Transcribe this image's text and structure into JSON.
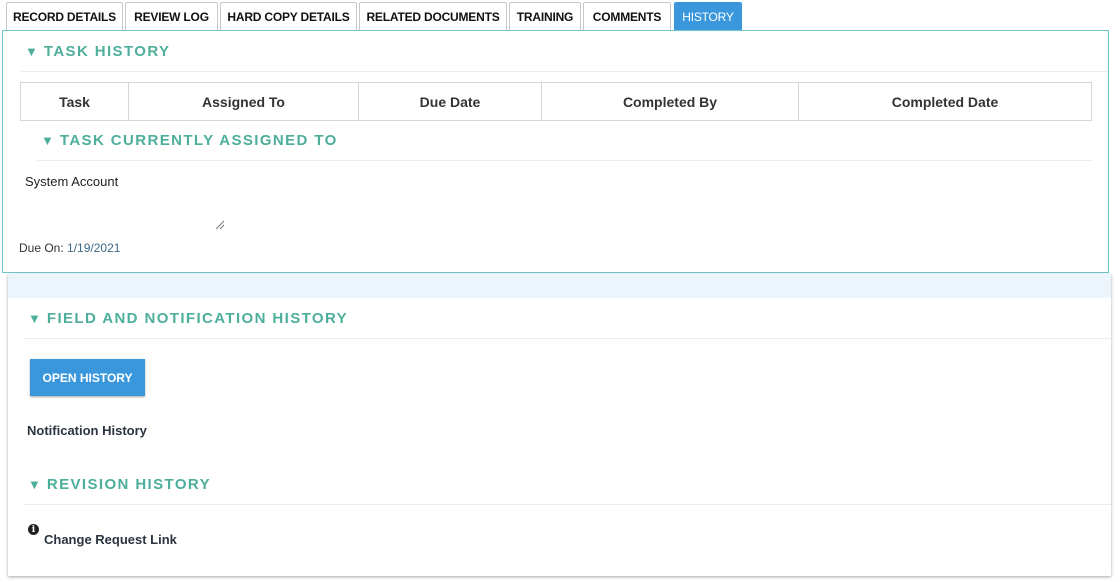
{
  "tabs": [
    {
      "label": "RECORD DETAILS",
      "active": false
    },
    {
      "label": "REVIEW LOG",
      "active": false
    },
    {
      "label": "HARD COPY DETAILS",
      "active": false
    },
    {
      "label": "RELATED DOCUMENTS",
      "active": false
    },
    {
      "label": "TRAINING",
      "active": false
    },
    {
      "label": "COMMENTS",
      "active": false
    },
    {
      "label": "HISTORY",
      "active": true
    }
  ],
  "task_history": {
    "title": "TASK HISTORY",
    "columns": [
      "Task",
      "Assigned To",
      "Due Date",
      "Completed By",
      "Completed Date"
    ],
    "assigned": {
      "title": "TASK CURRENTLY ASSIGNED TO",
      "assignee": "System Account",
      "due_label": "Due On:",
      "due_value": "1/19/2021"
    }
  },
  "field_history": {
    "title": "FIELD AND NOTIFICATION HISTORY",
    "open_button": "OPEN HISTORY",
    "notification_label": "Notification History"
  },
  "revision_history": {
    "title": "REVISION HISTORY",
    "info_icon": "info-circle-icon",
    "link": "Change Request Link"
  },
  "colors": {
    "accent_blue": "#3b97dc",
    "section_teal": "#4dae9b",
    "panel_border": "#6fc6cf"
  }
}
